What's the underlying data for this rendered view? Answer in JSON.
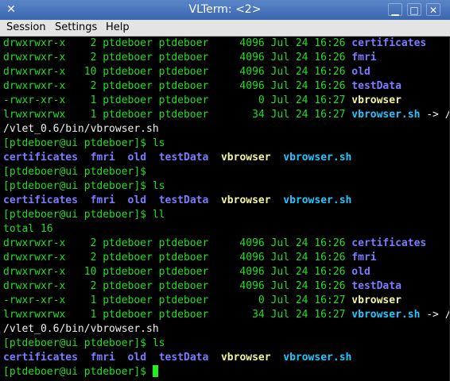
{
  "window": {
    "title": "VLTerm: <2>",
    "icon": "close-x-icon",
    "controls": {
      "minimize": "▁",
      "maximize": "□",
      "close": "✕"
    }
  },
  "menu": {
    "session": "Session",
    "settings": "Settings",
    "help": "Help"
  },
  "colors": {
    "green": "#22dd22",
    "blue": "#7b7bff",
    "cyan": "#23c6ff",
    "yellow": "#f4f49a",
    "title_bar": "#4a76bc"
  },
  "lines": [
    [
      {
        "t": "drwxrwxr-x    2 ptdeboer ptdeboer     4096 Jul 24 16:26 ",
        "c": "green"
      },
      {
        "t": "certificates",
        "c": "blue"
      }
    ],
    [
      {
        "t": "drwxrwxr-x    2 ptdeboer ptdeboer     4096 Jul 24 16:26 ",
        "c": "green"
      },
      {
        "t": "fmri",
        "c": "blue"
      }
    ],
    [
      {
        "t": "drwxrwxr-x   10 ptdeboer ptdeboer     4096 Jul 24 16:26 ",
        "c": "green"
      },
      {
        "t": "old",
        "c": "blue"
      }
    ],
    [
      {
        "t": "drwxrwxr-x    2 ptdeboer ptdeboer     4096 Jul 24 16:26 ",
        "c": "green"
      },
      {
        "t": "testData",
        "c": "blue"
      }
    ],
    [
      {
        "t": "-rwxr-xr-x    1 ptdeboer ptdeboer        0 Jul 24 16:27 ",
        "c": "green"
      },
      {
        "t": "vbrowser",
        "c": "yellow"
      }
    ],
    [
      {
        "t": "lrwxrwxrwx    1 ptdeboer ptdeboer       34 Jul 24 16:27 ",
        "c": "green"
      },
      {
        "t": "vbrowser.sh",
        "c": "cyan"
      },
      {
        "t": " -> /opt/vl-e",
        "c": "white"
      }
    ],
    [
      {
        "t": "/vlet_0.6/bin/vbrowser.sh",
        "c": "white"
      }
    ],
    [
      {
        "t": "[ptdeboer@ui ptdeboer]$ ls",
        "c": "green"
      }
    ],
    [
      {
        "t": "certificates",
        "c": "blue"
      },
      {
        "t": "  ",
        "c": "green"
      },
      {
        "t": "fmri",
        "c": "blue"
      },
      {
        "t": "  ",
        "c": "green"
      },
      {
        "t": "old",
        "c": "blue"
      },
      {
        "t": "  ",
        "c": "green"
      },
      {
        "t": "testData",
        "c": "blue"
      },
      {
        "t": "  ",
        "c": "green"
      },
      {
        "t": "vbrowser",
        "c": "yellow"
      },
      {
        "t": "  ",
        "c": "green"
      },
      {
        "t": "vbrowser.sh",
        "c": "cyan"
      }
    ],
    [
      {
        "t": "[ptdeboer@ui ptdeboer]$",
        "c": "green"
      }
    ],
    [
      {
        "t": "[ptdeboer@ui ptdeboer]$ ls",
        "c": "green"
      }
    ],
    [
      {
        "t": "certificates",
        "c": "blue"
      },
      {
        "t": "  ",
        "c": "green"
      },
      {
        "t": "fmri",
        "c": "blue"
      },
      {
        "t": "  ",
        "c": "green"
      },
      {
        "t": "old",
        "c": "blue"
      },
      {
        "t": "  ",
        "c": "green"
      },
      {
        "t": "testData",
        "c": "blue"
      },
      {
        "t": "  ",
        "c": "green"
      },
      {
        "t": "vbrowser",
        "c": "yellow"
      },
      {
        "t": "  ",
        "c": "green"
      },
      {
        "t": "vbrowser.sh",
        "c": "cyan"
      }
    ],
    [
      {
        "t": "[ptdeboer@ui ptdeboer]$ ll",
        "c": "green"
      }
    ],
    [
      {
        "t": "total 16",
        "c": "green"
      }
    ],
    [
      {
        "t": "drwxrwxr-x    2 ptdeboer ptdeboer     4096 Jul 24 16:26 ",
        "c": "green"
      },
      {
        "t": "certificates",
        "c": "blue"
      }
    ],
    [
      {
        "t": "drwxrwxr-x    2 ptdeboer ptdeboer     4096 Jul 24 16:26 ",
        "c": "green"
      },
      {
        "t": "fmri",
        "c": "blue"
      }
    ],
    [
      {
        "t": "drwxrwxr-x   10 ptdeboer ptdeboer     4096 Jul 24 16:26 ",
        "c": "green"
      },
      {
        "t": "old",
        "c": "blue"
      }
    ],
    [
      {
        "t": "drwxrwxr-x    2 ptdeboer ptdeboer     4096 Jul 24 16:26 ",
        "c": "green"
      },
      {
        "t": "testData",
        "c": "blue"
      }
    ],
    [
      {
        "t": "-rwxr-xr-x    1 ptdeboer ptdeboer        0 Jul 24 16:27 ",
        "c": "green"
      },
      {
        "t": "vbrowser",
        "c": "yellow"
      }
    ],
    [
      {
        "t": "lrwxrwxrwx    1 ptdeboer ptdeboer       34 Jul 24 16:27 ",
        "c": "green"
      },
      {
        "t": "vbrowser.sh",
        "c": "cyan"
      },
      {
        "t": " -> /opt/vl-e",
        "c": "white"
      }
    ],
    [
      {
        "t": "/vlet_0.6/bin/vbrowser.sh",
        "c": "white"
      }
    ],
    [
      {
        "t": "[ptdeboer@ui ptdeboer]$ ls",
        "c": "green"
      }
    ],
    [
      {
        "t": "certificates",
        "c": "blue"
      },
      {
        "t": "  ",
        "c": "green"
      },
      {
        "t": "fmri",
        "c": "blue"
      },
      {
        "t": "  ",
        "c": "green"
      },
      {
        "t": "old",
        "c": "blue"
      },
      {
        "t": "  ",
        "c": "green"
      },
      {
        "t": "testData",
        "c": "blue"
      },
      {
        "t": "  ",
        "c": "green"
      },
      {
        "t": "vbrowser",
        "c": "yellow"
      },
      {
        "t": "  ",
        "c": "green"
      },
      {
        "t": "vbrowser.sh",
        "c": "cyan"
      }
    ],
    [
      {
        "t": "[ptdeboer@ui ptdeboer]$ ",
        "c": "green"
      }
    ]
  ]
}
